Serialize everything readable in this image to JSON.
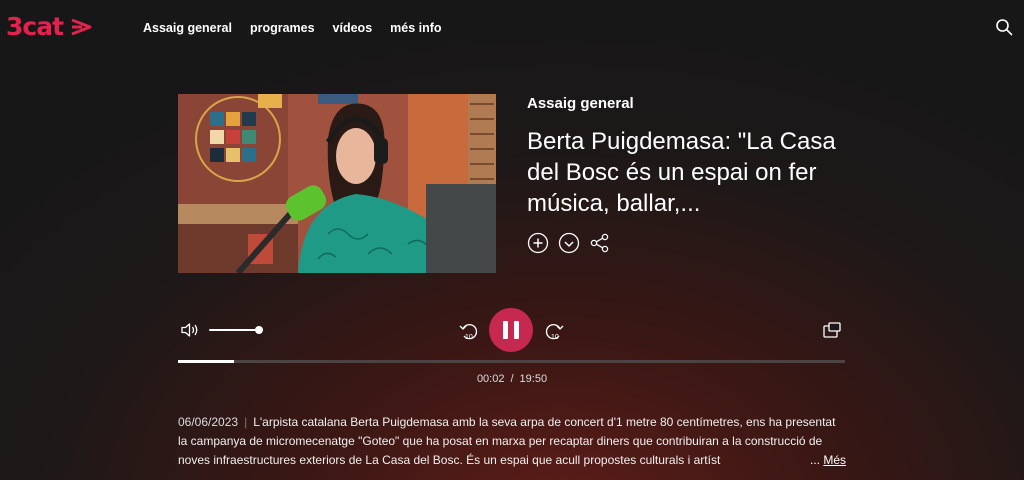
{
  "brand": {
    "logo_text": "3cat",
    "accent": "#e3224d"
  },
  "nav": {
    "items": [
      "Assaig general",
      "programes",
      "vídeos",
      "més info"
    ]
  },
  "header": {
    "search_icon": "search-icon"
  },
  "episode": {
    "program": "Assaig general",
    "title": "Berta Puigdemasa: \"La Casa del Bosc és un espai on fer música, ballar,...",
    "actions": [
      "add-icon",
      "download-icon",
      "share-icon"
    ]
  },
  "player": {
    "state": "playing",
    "current_time": "00:02",
    "time_separator": "/",
    "duration": "19:50",
    "progress_fraction": 0.084,
    "volume_fraction": 1.0,
    "rewind_seconds": "10",
    "forward_seconds": "10",
    "play_color": "#c7284f"
  },
  "description": {
    "date": "06/06/2023",
    "separator": "|",
    "text": "L'arpista catalana Berta Puigdemasa amb la seva arpa de concert d'1 metre 80 centímetres, ens ha presentat la campanya de micromecenatge \"Goteo\" que ha posat en marxa per recaptar diners que contribuiran a la construcció de noves infraestructures exteriors de La Casa del Bosc. És un espai que acull propostes culturals i artíst",
    "ellipsis": "...",
    "more_label": "Més"
  }
}
